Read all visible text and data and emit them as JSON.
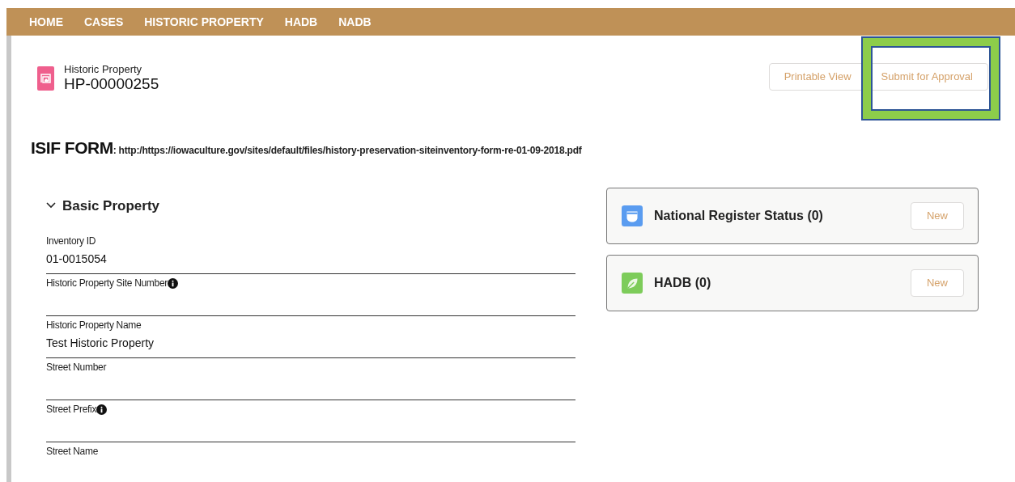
{
  "nav": [
    {
      "label": "HOME"
    },
    {
      "label": "CASES"
    },
    {
      "label": "HISTORIC PROPERTY"
    },
    {
      "label": "HADB"
    },
    {
      "label": "NADB"
    }
  ],
  "record": {
    "type": "Historic Property",
    "name": "HP-00000255"
  },
  "actions": [
    {
      "label": "Printable View",
      "highlighted": false
    },
    {
      "label": "Submit for Approval",
      "highlighted": true
    }
  ],
  "isif": {
    "label": "ISIF FORM",
    "link": ": http:/https://iowaculture.gov/sites/default/files/history-preservation-siteinventory-form-re-01-09-2018.pdf"
  },
  "section": {
    "title": "Basic Property",
    "expanded": true,
    "fields": [
      {
        "label": "Inventory ID",
        "value": "01-0015054",
        "info": false
      },
      {
        "label": "Historic Property Site Number",
        "info": true
      },
      {
        "label": "Historic Property Name",
        "value": "Test Historic Property",
        "info": false
      },
      {
        "label": "Street Number",
        "info": false
      },
      {
        "label": "Street Prefix",
        "info": true
      },
      {
        "label": "Street Name",
        "info": false
      }
    ]
  },
  "related": [
    {
      "title": "National Register Status (0)",
      "kind": "shield",
      "color": "#5a9cf0",
      "button": "New"
    },
    {
      "title": "HADB (0)",
      "kind": "leaf",
      "color": "#7dcc5a",
      "button": "New"
    }
  ]
}
